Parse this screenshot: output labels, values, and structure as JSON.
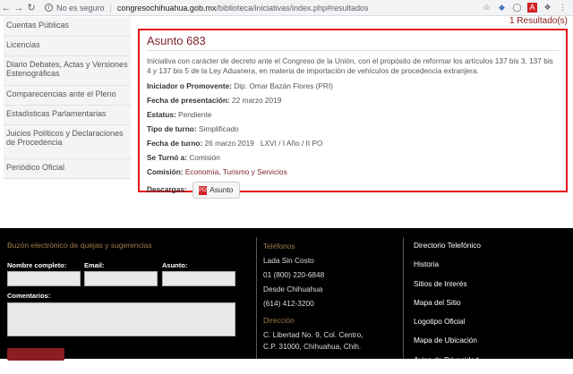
{
  "browser": {
    "security_label": "No es seguro",
    "url_host": "congresochihuahua.gob.mx",
    "url_path": "/biblioteca/iniciativas/index.php#resultados"
  },
  "results_count": "1 Resultado(s)",
  "sidebar": {
    "items": [
      {
        "label": "Cuentas Públicas"
      },
      {
        "label": "Licencias"
      },
      {
        "label": "Diario Debates, Actas y Versiones Estenográficas"
      },
      {
        "label": "Comparecencias ante el Pleno"
      },
      {
        "label": "Estadísticas Parlamentarias"
      },
      {
        "label": "Juicios Políticos y Declaraciones de Procedencia"
      },
      {
        "label": "Periódico Oficial"
      }
    ]
  },
  "asunto": {
    "title": "Asunto 683",
    "description": "Iniciativa con carácter de decreto ante el Congreso de la Unión, con el propósito de reformar los artículos 137 bis 3, 137 bis 4 y 137 bis 5 de la Ley Aduanera, en materia de importación de vehículos de procedencia extranjera.",
    "iniciador_label": "Iniciador o Promovente:",
    "iniciador_value": "Dip. Omar Bazán Flores (PRI)",
    "fecha_presentacion_label": "Fecha de presentación:",
    "fecha_presentacion_value": "22 marzo 2019",
    "estatus_label": "Estatus:",
    "estatus_value": "Pendiente",
    "tipo_turno_label": "Tipo de turno:",
    "tipo_turno_value": "Simplificado",
    "fecha_turno_label": "Fecha de turno:",
    "fecha_turno_value": "26 marzo 2019",
    "legislatura": "LXVI / I Año / II PO",
    "se_turno_label": "Se Turnó a:",
    "se_turno_value": "Comisión",
    "comision_label": "Comisión:",
    "comision_value": "Economía, Turismo y Servicios",
    "descargas_label": "Descargas:",
    "descarga_button": "Asunto",
    "pdf_glyph": "PDF"
  },
  "footer": {
    "buzon_title": "Buzón electrónico de quejas y sugerencias",
    "nombre_label": "Nombre completo:",
    "email_label": "Email:",
    "asunto_label": "Asunto:",
    "comentarios_label": "Comentarios:",
    "telefonos_title": "Teléfonos",
    "lada_label": "Lada Sin Costo",
    "lada_number": "01 (800) 220-6848",
    "desde_label": "Desde Chihuahua",
    "desde_number": "(614) 412-3200",
    "direccion_title": "Dirección",
    "direccion_line1": "C. Libertad No. 9, Col. Centro,",
    "direccion_line2": "C.P. 31000, Chihuahua, Chih.",
    "links": [
      {
        "label": "Directorio Telefónico"
      },
      {
        "label": "Historia"
      },
      {
        "label": "Sitios de Interés"
      },
      {
        "label": "Mapa del Sitio"
      },
      {
        "label": "Logotipo Oficial"
      },
      {
        "label": "Mapa de Ubicación"
      },
      {
        "label": "Aviso de Privacidad"
      }
    ]
  },
  "colors": {
    "accent": "#7b1f2a",
    "highlight_border": "#e8121c",
    "footer_bg": "#000000",
    "footer_heading": "#a07b4a"
  }
}
